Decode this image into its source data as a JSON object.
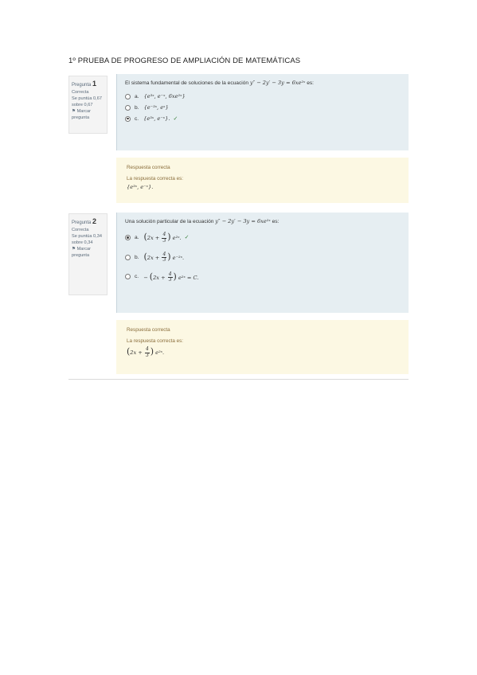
{
  "page": {
    "title": "1º PRUEBA DE PROGRESO DE AMPLIACIÓN DE MATEMÁTICAS"
  },
  "questions": [
    {
      "info": {
        "label": "Pregunta",
        "number": "1",
        "status": "Correcta",
        "score": "Se puntúa 0,67 sobre 0,67",
        "flag": "Marcar pregunta"
      },
      "text": "El sistema fundamental de soluciones de la ecuación",
      "equation": "y″ − 2y′ − 3y = 6xe²ˣ",
      "text_end": "es:",
      "options": [
        {
          "label": "a.",
          "math": "{e³ˣ, e⁻ˣ, 6xe²ˣ}",
          "selected": false,
          "check": ""
        },
        {
          "label": "b.",
          "math": "{e⁻³ˣ, eˣ}",
          "selected": false,
          "check": ""
        },
        {
          "label": "c.",
          "math": "{e³ˣ, e⁻ˣ}.",
          "selected": true,
          "check": "✓"
        }
      ],
      "feedback": {
        "label": "Respuesta correcta",
        "answer_label": "La respuesta correcta es:",
        "answer_math": "{e³ˣ, e⁻ˣ}."
      }
    },
    {
      "info": {
        "label": "Pregunta",
        "number": "2",
        "status": "Correcta",
        "score": "Se puntúa 0,34 sobre 0,34",
        "flag": "Marcar pregunta"
      },
      "text": "Una solución particular de la ecuación",
      "equation": "y″ − 2y′ − 3y = 6xe²ˣ",
      "text_end": "es:",
      "options": [
        {
          "label": "a.",
          "pre": "",
          "mid": "2x + ",
          "num": "4",
          "den": "3",
          "post": "e²ˣ.",
          "selected": true,
          "check": "✓"
        },
        {
          "label": "b.",
          "pre": "",
          "mid": "2x + ",
          "num": "4",
          "den": "3",
          "post": "e⁻²ˣ.",
          "selected": false,
          "check": ""
        },
        {
          "label": "c.",
          "pre": "−",
          "mid": "2x + ",
          "num": "4",
          "den": "3",
          "post": "e²ˣ = C.",
          "selected": false,
          "check": ""
        }
      ],
      "feedback": {
        "label": "Respuesta correcta",
        "answer_label": "La respuesta correcta es:",
        "mid": "2x + ",
        "num": "4",
        "den": "3",
        "post": "e²ˣ."
      }
    }
  ],
  "icons": {
    "flag": "flag-icon",
    "check": "check-icon"
  },
  "colors": {
    "question_bg": "#e6eef2",
    "feedback_bg": "#fcf8e3",
    "info_bg": "#f4f4f4",
    "check": "#3a7f3a"
  }
}
